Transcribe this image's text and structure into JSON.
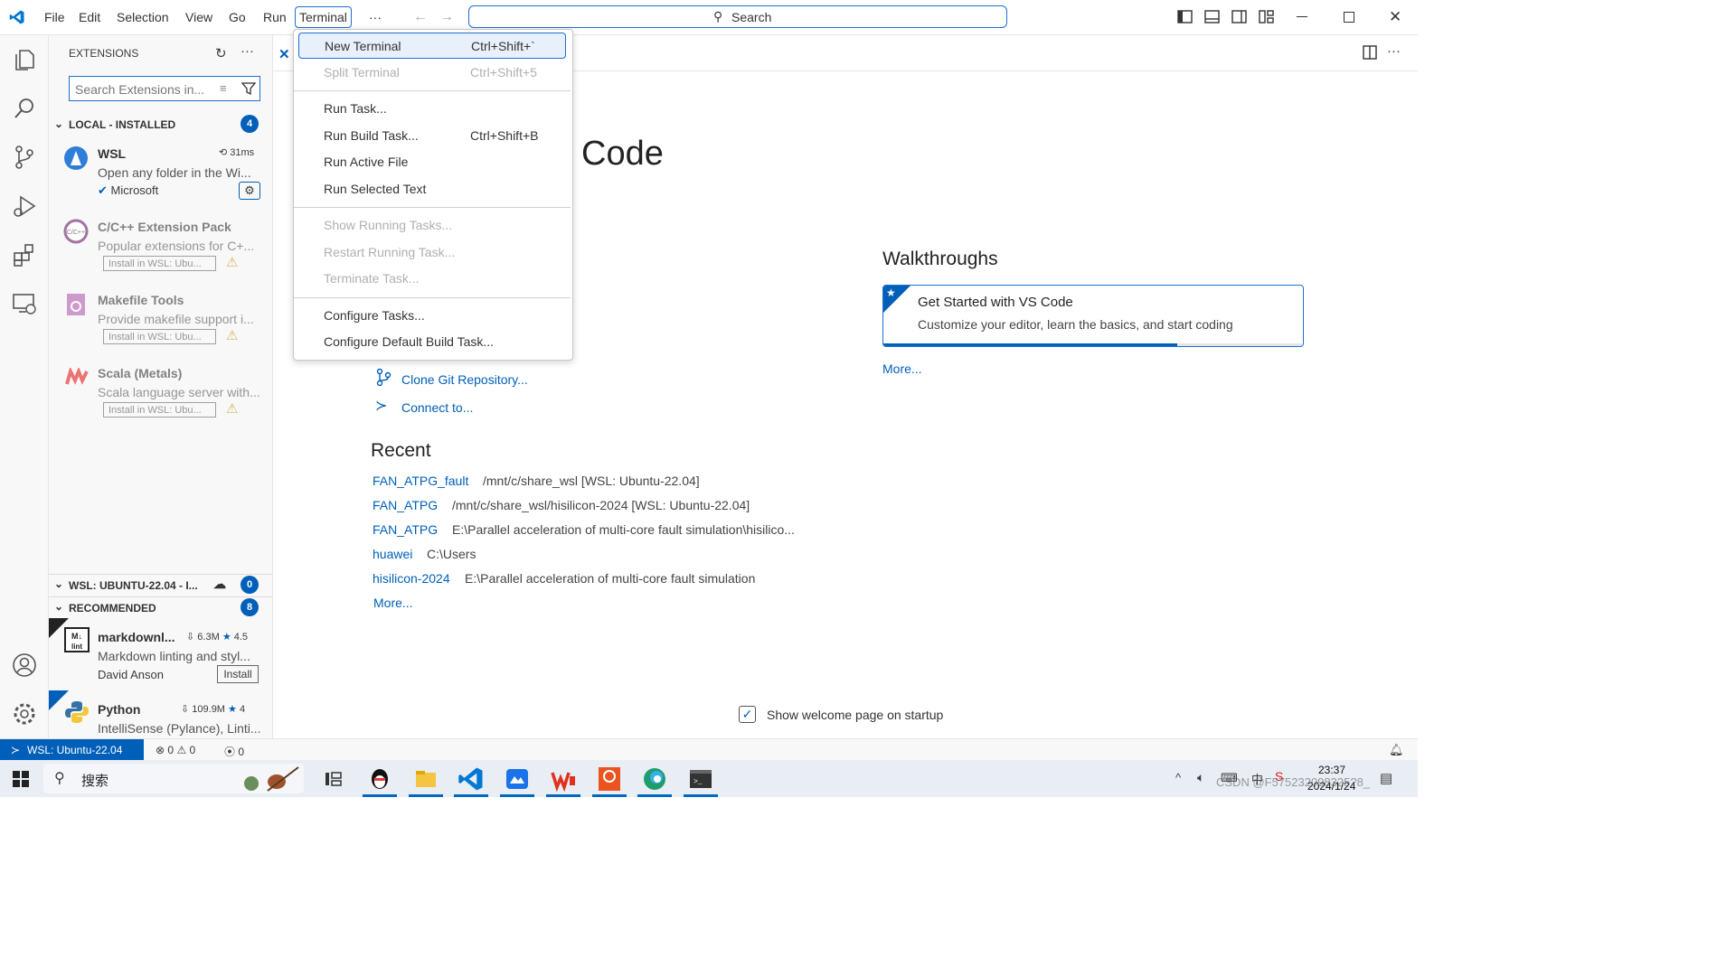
{
  "titlebar": {
    "menus": [
      "File",
      "Edit",
      "Selection",
      "View",
      "Go",
      "Run",
      "Terminal",
      "···"
    ],
    "search_label": "Search"
  },
  "terminal_menu": {
    "groups": [
      [
        {
          "label": "New Terminal",
          "shortcut": "Ctrl+Shift+`",
          "enabled": true,
          "selected": true
        },
        {
          "label": "Split Terminal",
          "shortcut": "Ctrl+Shift+5",
          "enabled": false
        }
      ],
      [
        {
          "label": "Run Task...",
          "shortcut": "",
          "enabled": true
        },
        {
          "label": "Run Build Task...",
          "shortcut": "Ctrl+Shift+B",
          "enabled": true
        },
        {
          "label": "Run Active File",
          "shortcut": "",
          "enabled": true
        },
        {
          "label": "Run Selected Text",
          "shortcut": "",
          "enabled": true
        }
      ],
      [
        {
          "label": "Show Running Tasks...",
          "shortcut": "",
          "enabled": false
        },
        {
          "label": "Restart Running Task...",
          "shortcut": "",
          "enabled": false
        },
        {
          "label": "Terminate Task...",
          "shortcut": "",
          "enabled": false
        }
      ],
      [
        {
          "label": "Configure Tasks...",
          "shortcut": "",
          "enabled": true
        },
        {
          "label": "Configure Default Build Task...",
          "shortcut": "",
          "enabled": true
        }
      ]
    ]
  },
  "sidebar": {
    "title": "EXTENSIONS",
    "search_placeholder": "Search Extensions in...",
    "local_installed": {
      "label": "LOCAL - INSTALLED",
      "count": "4",
      "items": [
        {
          "name": "WSL",
          "desc": "Open any folder in the Wi...",
          "publisher": "Microsoft",
          "time": "31ms"
        },
        {
          "name": "C/C++ Extension Pack",
          "desc": "Popular extensions for C+...",
          "install": "Install in WSL: Ubu..."
        },
        {
          "name": "Makefile Tools",
          "desc": "Provide makefile support i...",
          "install": "Install in WSL: Ubu..."
        },
        {
          "name": "Scala (Metals)",
          "desc": "Scala language server with...",
          "install": "Install in WSL: Ubu..."
        }
      ]
    },
    "wsl_section": {
      "label": "WSL: UBUNTU-22.04 - I...",
      "count": "0"
    },
    "recommended": {
      "label": "RECOMMENDED",
      "count": "8",
      "items": [
        {
          "name": "markdownl...",
          "downloads": "6.3M",
          "rating": "4.5",
          "desc": "Markdown linting and styl...",
          "publisher": "David Anson",
          "install": "Install"
        },
        {
          "name": "Python",
          "downloads": "109.9M",
          "rating": "4",
          "desc": "IntelliSense (Pylance), Linti..."
        }
      ]
    }
  },
  "welcome": {
    "title_fragment": "Code",
    "start_links": [
      "Clone Git Repository...",
      "Connect to..."
    ],
    "recent_title": "Recent",
    "recent": [
      {
        "name": "FAN_ATPG_fault",
        "path": "/mnt/c/share_wsl [WSL: Ubuntu-22.04]"
      },
      {
        "name": "FAN_ATPG",
        "path": "/mnt/c/share_wsl/hisilicon-2024 [WSL: Ubuntu-22.04]"
      },
      {
        "name": "FAN_ATPG",
        "path": "E:\\Parallel acceleration of multi-core fault simulation\\hisilico..."
      },
      {
        "name": "huawei",
        "path": "C:\\Users"
      },
      {
        "name": "hisilicon-2024",
        "path": "E:\\Parallel acceleration of multi-core fault simulation"
      }
    ],
    "recent_more": "More...",
    "walkthroughs_title": "Walkthroughs",
    "walkthrough_card": {
      "title": "Get Started with VS Code",
      "desc": "Customize your editor, learn the basics, and start coding",
      "progress": 0.7
    },
    "walkthroughs_more": "More...",
    "show_on_startup": "Show welcome page on startup"
  },
  "statusbar": {
    "remote": "WSL: Ubuntu-22.04",
    "errors": "0",
    "warnings": "0",
    "ports": "0"
  },
  "taskbar": {
    "search": "搜索",
    "time": "23:37",
    "date": "2024/1/24",
    "watermark": "CSDN @F575232098325?8_"
  },
  "colors": {
    "accent": "#005fb8",
    "link": "#005fb8"
  }
}
